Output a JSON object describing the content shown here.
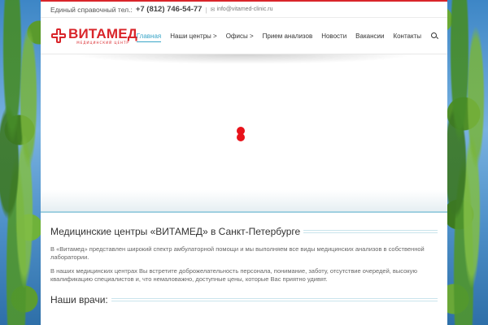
{
  "topbar": {
    "phone_label": "Единый справочный тел.:",
    "phone": "+7 (812) 746-54-77",
    "separator": "|",
    "mail_icon": "mail-icon",
    "email": "info@vitamed-clinic.ru"
  },
  "logo": {
    "text": "ВИТАМЕД",
    "subtitle": "МЕДИЦИНСКИЙ ЦЕНТР",
    "icon": "medical-cross-icon"
  },
  "nav": {
    "items": [
      {
        "label": "Главная",
        "active": true
      },
      {
        "label": "Наши центры >"
      },
      {
        "label": "Офисы >"
      },
      {
        "label": "Прием анализов"
      },
      {
        "label": "Новости"
      },
      {
        "label": "Вакансии"
      },
      {
        "label": "Контакты"
      }
    ],
    "search_icon": "search-icon"
  },
  "slider": {
    "loader_icon": "loading-dots-icon"
  },
  "main": {
    "title": "Медицинские центры «ВИТАМЕД» в Санкт-Петербурге",
    "paragraph1": "В «Витамед» представлен широкий спектр амбулаторной помощи и мы выполняем все виды медицинских анализов в собственной лаборатории.",
    "paragraph2": "В наших медицинских центрах Вы встретите доброжелательность персонала, понимание, заботу, отсутствие очередей, высокую квалификацию специалистов и, что немаловажно, доступные цены, которые Вас приятно удивят.",
    "doctors_title": "Наши врачи:"
  },
  "colors": {
    "brand_red": "#d9252a",
    "accent_blue": "#3aa6c8",
    "loader_red": "#e8131b"
  }
}
